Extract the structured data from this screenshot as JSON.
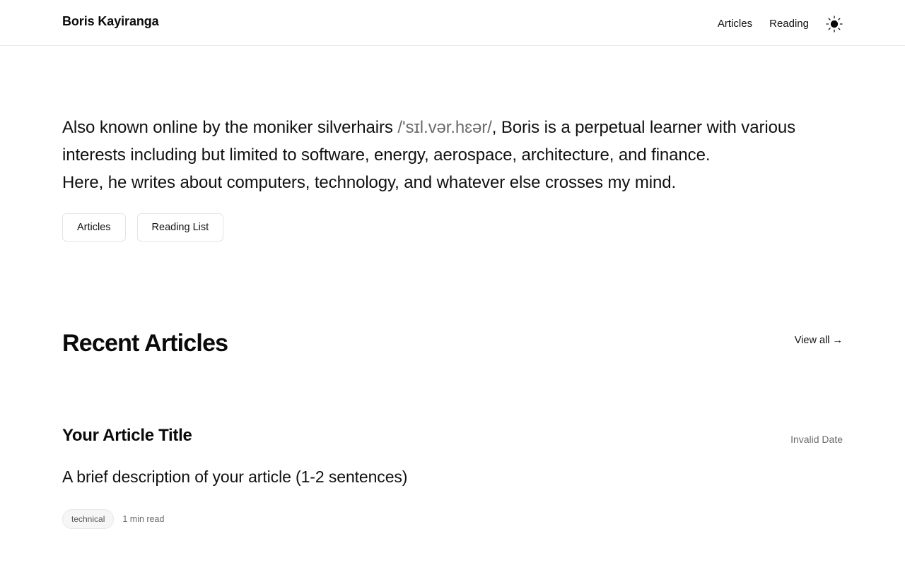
{
  "header": {
    "site_title": "Boris Kayiranga",
    "nav": [
      {
        "label": "Articles"
      },
      {
        "label": "Reading"
      }
    ],
    "theme_toggle_icon": "sun-icon"
  },
  "intro": {
    "lead": "Also known online by the moniker silverhairs ",
    "phonetic": "/'sɪl.vər.hɛər/",
    "rest": ", Boris is a perpetual learner with various interests including but limited to software, energy, aerospace, architecture, and finance.",
    "line2": "Here, he writes about computers, technology, and whatever else crosses my mind.",
    "buttons": [
      {
        "label": "Articles"
      },
      {
        "label": "Reading List"
      }
    ]
  },
  "recent": {
    "title": "Recent Articles",
    "view_all": "View all →",
    "articles": [
      {
        "title": "Your Article Title",
        "date": "Invalid Date",
        "description": "A brief description of your article (1-2 sentences)",
        "tag": "technical",
        "read_time": "1 min read"
      }
    ]
  }
}
